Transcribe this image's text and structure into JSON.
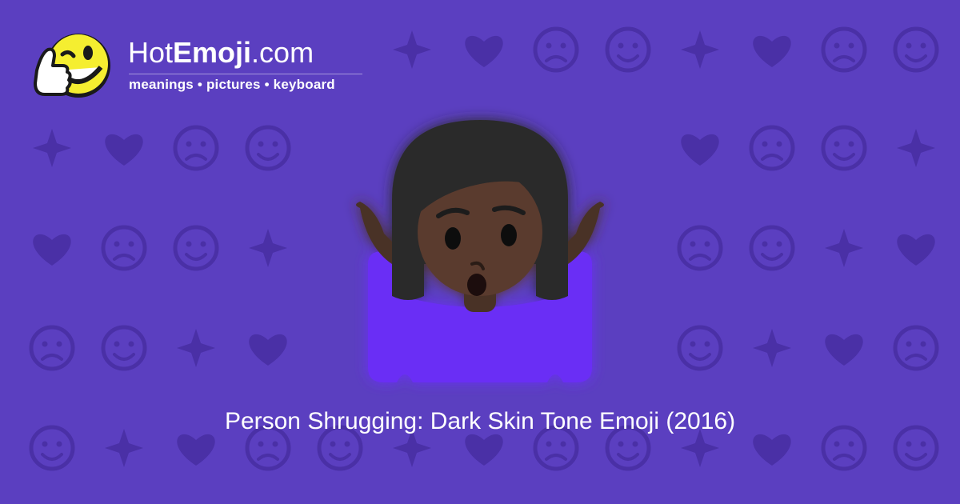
{
  "site": {
    "brand_light": "Hot",
    "brand_bold": "Emoji",
    "brand_suffix": ".com",
    "tagline": "meanings • pictures • keyboard",
    "mascot_icon": "thumbs-up-winking-face-icon"
  },
  "emoji": {
    "title": "Person Shrugging: Dark Skin Tone Emoji (2016)",
    "icon": "person-shrugging-dark-skin-tone-icon"
  },
  "background": {
    "color": "#5b3fc0",
    "pattern_color": "#4a30a6",
    "pattern_icons": [
      "smiley-icon",
      "kiss-face-icon",
      "hearts-icon",
      "heart-icon",
      "broken-heart-icon",
      "fire-icon",
      "rose-icon",
      "sun-icon",
      "arrow-left-icon",
      "check-icon",
      "music-notes-icon",
      "sparkles-icon",
      "recycle-icon",
      "eyes-icon",
      "ok-hand-icon",
      "monkey-icon",
      "camera-icon",
      "flexed-biceps-icon"
    ]
  },
  "colors": {
    "mascot_yellow": "#f5ee30",
    "shirt": "#6a2ef5",
    "skin": "#5a3a2e",
    "hair": "#2b2b2b"
  }
}
